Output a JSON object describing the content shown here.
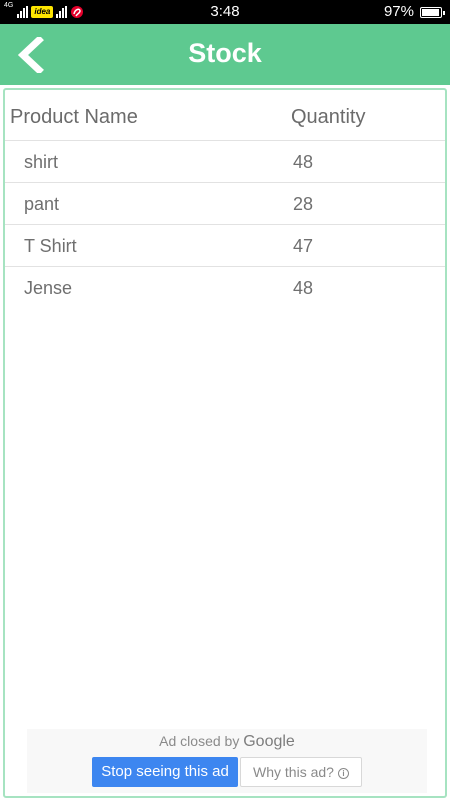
{
  "status_bar": {
    "network_type": "4G",
    "carrier": "idea",
    "time": "3:48",
    "battery_percent": "97%",
    "battery_level": 0.97
  },
  "app_bar": {
    "back_icon": "chevron-left-icon",
    "title": "Stock",
    "color": "#5ec990"
  },
  "table": {
    "columns": [
      "Product Name",
      "Quantity"
    ],
    "rows": [
      {
        "name": "shirt",
        "quantity": "48"
      },
      {
        "name": "pant",
        "quantity": "28"
      },
      {
        "name": "T Shirt",
        "quantity": "47"
      },
      {
        "name": "Jense",
        "quantity": "48"
      }
    ]
  },
  "ad": {
    "closed_prefix": "Ad closed by",
    "brand": "Google",
    "stop_label": "Stop seeing this ad",
    "why_label": "Why this ad?",
    "info_icon": "info-icon",
    "stop_color": "#3d86f0"
  }
}
